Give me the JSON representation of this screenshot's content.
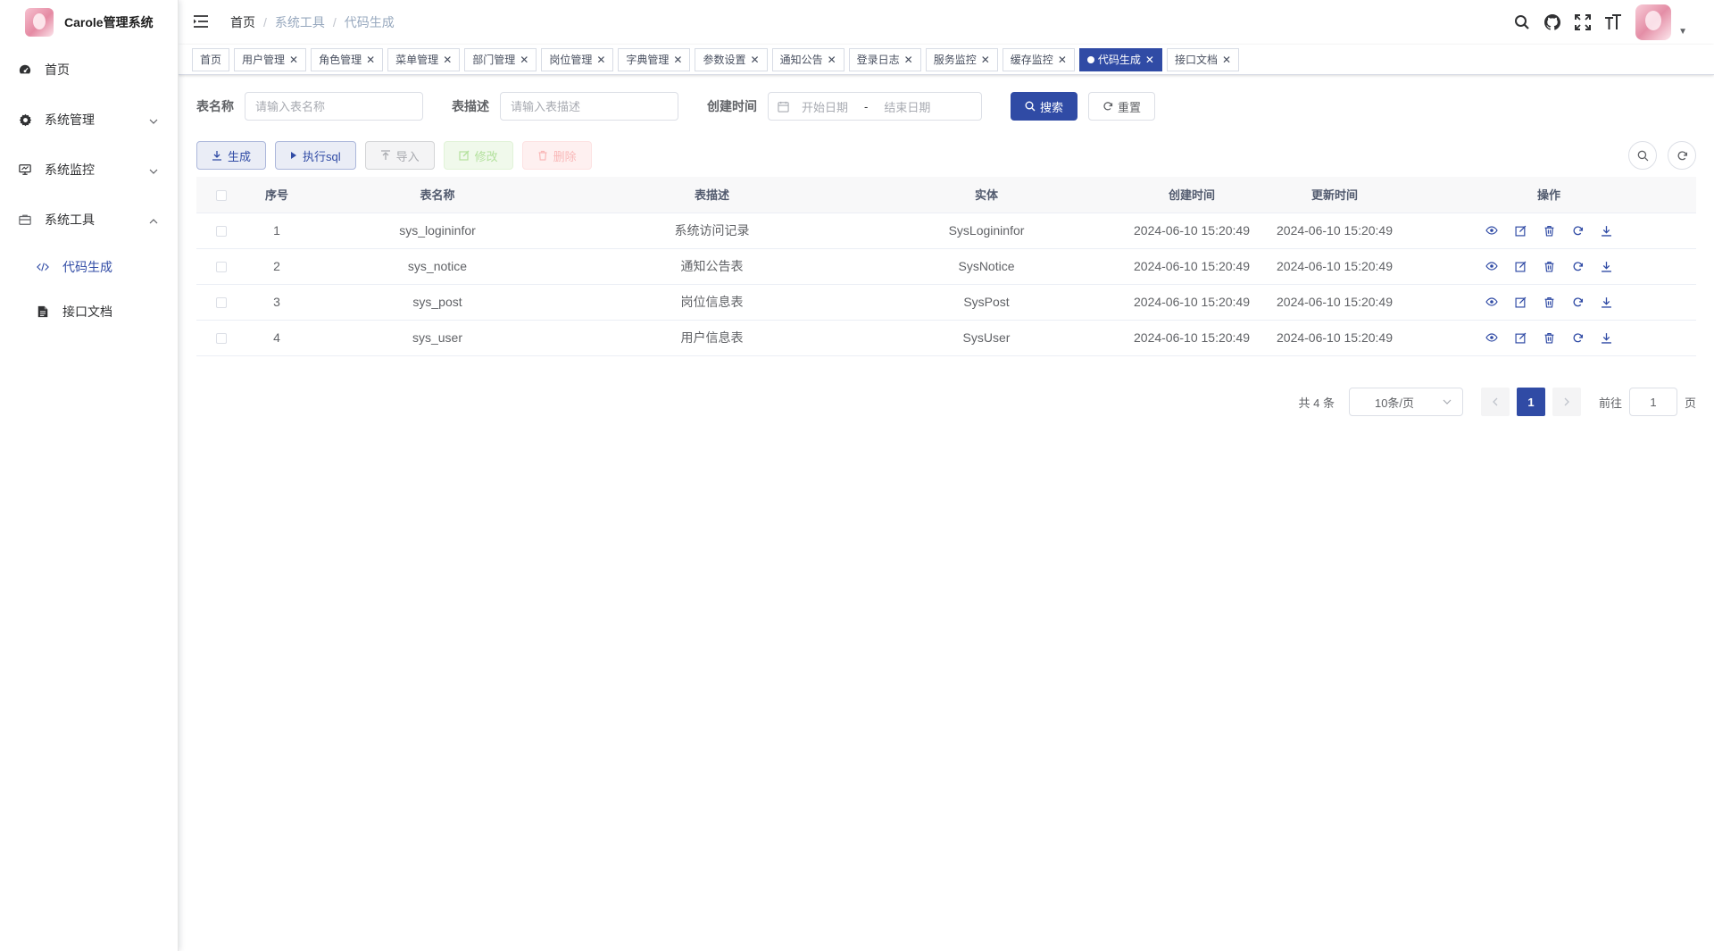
{
  "app": {
    "title": "Carole管理系统"
  },
  "sidebar": {
    "items": [
      {
        "label": "首页",
        "icon": "dashboard-icon"
      },
      {
        "label": "系统管理",
        "icon": "gear-icon"
      },
      {
        "label": "系统监控",
        "icon": "monitor-icon"
      },
      {
        "label": "系统工具",
        "icon": "toolbox-icon"
      }
    ],
    "sub_items": [
      {
        "label": "代码生成",
        "icon": "code-icon",
        "active": true
      },
      {
        "label": "接口文档",
        "icon": "document-icon",
        "active": false
      }
    ]
  },
  "breadcrumb": [
    "首页",
    "系统工具",
    "代码生成"
  ],
  "tags": [
    {
      "label": "首页",
      "closable": false
    },
    {
      "label": "用户管理",
      "closable": true
    },
    {
      "label": "角色管理",
      "closable": true
    },
    {
      "label": "菜单管理",
      "closable": true
    },
    {
      "label": "部门管理",
      "closable": true
    },
    {
      "label": "岗位管理",
      "closable": true
    },
    {
      "label": "字典管理",
      "closable": true
    },
    {
      "label": "参数设置",
      "closable": true
    },
    {
      "label": "通知公告",
      "closable": true
    },
    {
      "label": "登录日志",
      "closable": true
    },
    {
      "label": "服务监控",
      "closable": true
    },
    {
      "label": "缓存监控",
      "closable": true
    },
    {
      "label": "代码生成",
      "closable": true,
      "active": true
    },
    {
      "label": "接口文档",
      "closable": true
    }
  ],
  "search": {
    "table_name_label": "表名称",
    "table_name_placeholder": "请输入表名称",
    "table_desc_label": "表描述",
    "table_desc_placeholder": "请输入表描述",
    "create_time_label": "创建时间",
    "start_date_placeholder": "开始日期",
    "range_separator": "-",
    "end_date_placeholder": "结束日期",
    "search_button": "搜索",
    "reset_button": "重置"
  },
  "toolbar": {
    "generate": "生成",
    "exec_sql": "执行sql",
    "import": "导入",
    "edit": "修改",
    "delete": "删除"
  },
  "table": {
    "headers": [
      "序号",
      "表名称",
      "表描述",
      "实体",
      "创建时间",
      "更新时间",
      "操作"
    ],
    "rows": [
      {
        "index": "1",
        "name": "sys_logininfor",
        "desc": "系统访问记录",
        "entity": "SysLogininfor",
        "created": "2024-06-10 15:20:49",
        "updated": "2024-06-10 15:20:49"
      },
      {
        "index": "2",
        "name": "sys_notice",
        "desc": "通知公告表",
        "entity": "SysNotice",
        "created": "2024-06-10 15:20:49",
        "updated": "2024-06-10 15:20:49"
      },
      {
        "index": "3",
        "name": "sys_post",
        "desc": "岗位信息表",
        "entity": "SysPost",
        "created": "2024-06-10 15:20:49",
        "updated": "2024-06-10 15:20:49"
      },
      {
        "index": "4",
        "name": "sys_user",
        "desc": "用户信息表",
        "entity": "SysUser",
        "created": "2024-06-10 15:20:49",
        "updated": "2024-06-10 15:20:49"
      }
    ]
  },
  "pagination": {
    "total": "共 4 条",
    "page_size": "10条/页",
    "current_page": "1",
    "goto_label": "前往",
    "goto_value": "1",
    "page_suffix": "页"
  },
  "colors": {
    "primary": "#304ba5",
    "border": "#dcdfe6"
  }
}
